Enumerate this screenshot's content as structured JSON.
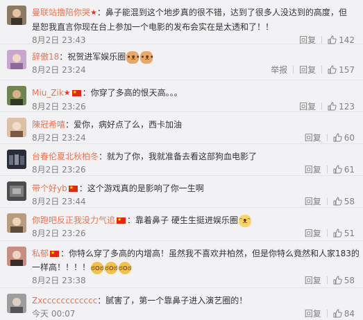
{
  "comments": [
    {
      "username": "曼联站撸陪你哭",
      "name_prefix": "",
      "text": "：鼻子能混到这个地步真的很不错，达到了很多人没达到的高度，但",
      "text2": "是恕我直言你现在台上参加一个电影的发布会实在是太透和了！！",
      "time": "8月2日 23:43",
      "reply_label": "回复",
      "report_label": "",
      "like_count": "142",
      "avatar_color": "#7a6a55"
    },
    {
      "username": "辞傲18",
      "text": "：祝贺进军娱乐圈",
      "time": "8月2日 23:24",
      "reply_label": "回复",
      "report_label": "举报",
      "like_count": "157",
      "avatar_color": "#c7a3c9"
    },
    {
      "username": "Miu_Zik",
      "text": "：你穿了多高的恨天高。。。",
      "time": "8月2日 23:26",
      "reply_label": "回复",
      "like_count": "123",
      "avatar_color": "#6b7f4b"
    },
    {
      "username": "陳冠希嘻",
      "text": "：爱你，病好点了么，西卡加油",
      "time": "8月2日 23:24",
      "reply_label": "回复",
      "like_count": "60",
      "avatar_color": "#d8b8a0"
    },
    {
      "username": "台春伦夏北秋柏冬",
      "text": "：就为了你，我就准备去看这部狗血电影了",
      "time": "8月2日 23:26",
      "reply_label": "回复",
      "like_count": "61",
      "avatar_color": "#2c2f3a"
    },
    {
      "username": "带个好yb",
      "text": "：这个游戏真的是影响了你一生啊",
      "time": "8月2日 23:44",
      "reply_label": "回复",
      "like_count": "58",
      "avatar_color": "#4d4d4d"
    },
    {
      "username": "你跑吧反正我没力气追",
      "text": "：靠着鼻子  硬生生挺进娱乐圈",
      "time": "8月2日 23:26",
      "reply_label": "回复",
      "like_count": "51",
      "avatar_color": "#b79a7e"
    },
    {
      "username": "私郁",
      "text": "：你特么穿了多高的内增高！虽然我不喜欢井柏然，但是你特么竟然和人家183的",
      "text2": "一样高！！！！",
      "time": "8月2日 23:38",
      "reply_label": "回复",
      "like_count": "58",
      "avatar_color": "#c58a7d"
    },
    {
      "username": "Zxcccccccccccc",
      "text": "：腻害了，第一个靠鼻子进入演艺圈的！",
      "time": "今天 00:07",
      "reply_label": "回复",
      "like_count": "84",
      "avatar_color": "#9c9c9c"
    }
  ],
  "icons": {
    "thumb": "thumbs-up-icon",
    "vip_star": "vip-star-icon",
    "flag": "china-flag-icon"
  },
  "colors": {
    "username": "#eb7350",
    "meta": "#808080",
    "background": "#f2f2f5"
  }
}
